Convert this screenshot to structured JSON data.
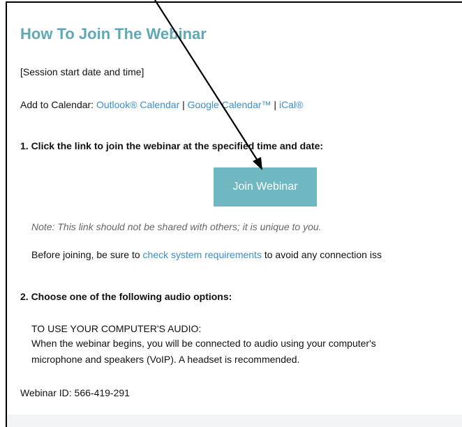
{
  "title": "How To Join The Webinar",
  "session_time": "[Session start date and time]",
  "calendar": {
    "label": "Add to Calendar:",
    "outlook": "Outlook® Calendar",
    "google": "Google Calendar™",
    "ical": "iCal®",
    "separator": "|"
  },
  "step1": {
    "heading": "1. Click the link to join the webinar at the specified time and date:",
    "button_label": "Join Webinar",
    "note": "Note: This link should not be shared with others; it is unique to you.",
    "requirements_before": "Before joining, be sure to",
    "requirements_link": "check system requirements",
    "requirements_after": "to avoid any connection iss"
  },
  "step2": {
    "heading": "2. Choose one of the following audio options:",
    "audio_title": "TO USE YOUR COMPUTER'S AUDIO:",
    "audio_desc_1": "When the webinar begins, you will be connected to audio using your computer's",
    "audio_desc_2": "microphone and speakers (VoIP). A headset is recommended."
  },
  "webinar_id": "Webinar ID: 566-419-291",
  "colors": {
    "accent": "#5fa9b6",
    "button": "#6fb8c1",
    "link": "#3a8fd0"
  }
}
